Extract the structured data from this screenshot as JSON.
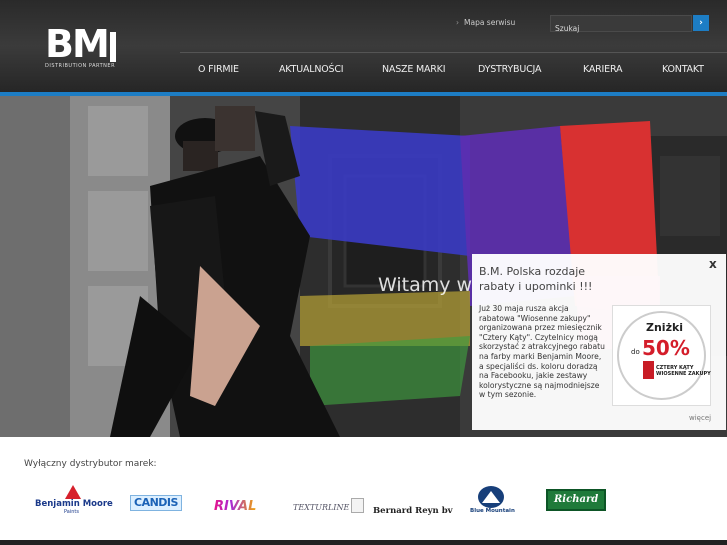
{
  "header": {
    "logo_text": "BM",
    "logo_tagline": "DISTRIBUTION PARTNER",
    "sitemap_label": "Mapa serwisu",
    "search": {
      "placeholder": "Szukaj",
      "button": "›"
    },
    "nav": [
      "O FIRMIE",
      "AKTUALNOŚCI",
      "NASZE MARKI",
      "DYSTRYBUCJA",
      "KARIERA",
      "KONTAKT"
    ]
  },
  "hero": {
    "welcome": "Witamy w"
  },
  "popup": {
    "close": "x",
    "title": "B.M. Polska rozdaje rabaty i upominki !!!",
    "text": "Już 30 maja rusza akcja rabatowa \"Wiosenne zakupy\" organizowana przez miesięcznik \"Cztery Kąty\". Czytelnicy mogą skorzystać z atrakcyjnego rabatu na farby marki Benjamin Moore, a specjaliści ds. koloru doradzą na Facebooku, jakie zestawy kolorystyczne są najmodniejsze w tym sezonie.",
    "promo": {
      "heading": "Zniżki",
      "prefix": "do",
      "percent": "50%",
      "brand": "CZTERY KĄTY",
      "sub": "WIOSENNE ZAKUPY"
    },
    "more": "więcej"
  },
  "brands": {
    "label": "Wyłączny dystrybutor marek:",
    "items": {
      "benjamin_moore": {
        "name": "Benjamin Moore",
        "sub": "Paints"
      },
      "candis": "CANDIS",
      "rival": "RIVAL",
      "texturline": "TEXTURLINE",
      "bernard_reyn": "Bernard Reyn bv",
      "blue_mountain": "Blue Mountain",
      "richard": "Richard"
    }
  },
  "colors": {
    "accent": "#1d7dc4",
    "header_bg": "#2f2f2f",
    "promo_red": "#d41d2a"
  }
}
